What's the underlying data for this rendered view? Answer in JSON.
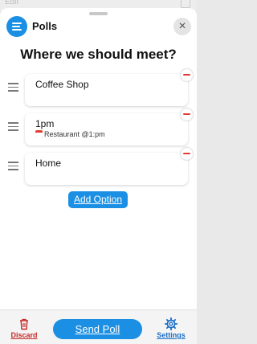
{
  "background": {
    "left_text": "Edit"
  },
  "header": {
    "title": "Polls",
    "close_symbol": "×",
    "icon": "list-icon"
  },
  "question": "Where we should meet?",
  "options": [
    {
      "text": "Coffee Shop",
      "subtitle": ""
    },
    {
      "text": "1pm",
      "subtitle": "Restaurant @1:pm",
      "subtitle_icon": "calendar-icon"
    },
    {
      "text": "Home",
      "subtitle": ""
    }
  ],
  "add_option_label": "Add Option",
  "toolbar": {
    "discard_label": "Discard",
    "send_label": "Send Poll",
    "settings_label": "Settings"
  },
  "colors": {
    "accent": "#1a8fe3",
    "remove": "#e53935",
    "discard": "#c62828",
    "settings": "#1a6fc7"
  }
}
